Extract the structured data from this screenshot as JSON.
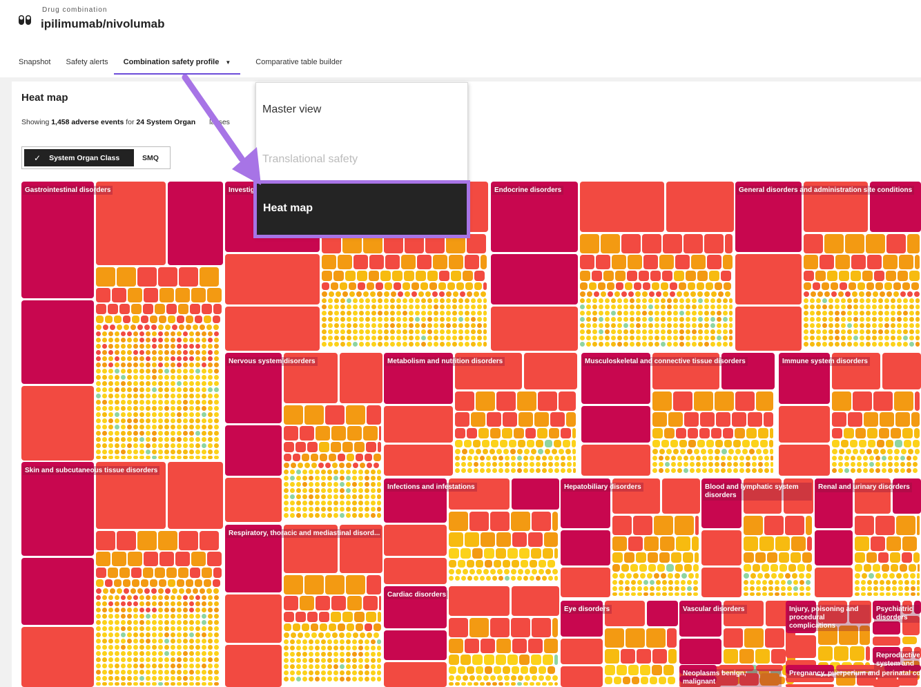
{
  "header": {
    "kicker": "Drug combination",
    "drug_name": "ipilimumab/nivolumab",
    "icon": "pill-capsules-icon"
  },
  "tabs": [
    {
      "label": "Snapshot"
    },
    {
      "label": "Safety alerts"
    },
    {
      "label": "Combination safety profile",
      "active": true
    },
    {
      "label": "Comparative table builder"
    }
  ],
  "panel": {
    "title": "Heat map",
    "showing_prefix": "Showing ",
    "event_count": "1,458 adverse events",
    "showing_mid": " for ",
    "soc_count": "24 System Organ",
    "showing_suffix": "lasses"
  },
  "toggle": {
    "selected": "System Organ Class",
    "other": "SMQ"
  },
  "dropdown": {
    "items": [
      "Master view",
      "Translational safety",
      "Heat map"
    ],
    "disabled": "Translational safety",
    "selected": "Heat map"
  },
  "treemap": {
    "groups": [
      "Gastrointestinal disorders",
      "Investig",
      "Endocrine disorders",
      "General disorders and administration site conditions",
      "Nervous system disorders",
      "Metabolism and nutrition disorders",
      "Musculoskeletal and connective tissue disorders",
      "Immune system disorders",
      "Skin and subcutaneous tissue disorders",
      "Infections and infestations",
      "Hepatobiliary disorders",
      "Blood and lymphatic system disorders",
      "Renal and urinary disorders",
      "Respiratory, thoracic and mediastinal disord...",
      "Cardiac disorders",
      "Eye disorders",
      "Vascular disorders",
      "Injury, poisoning and procedural complications",
      "Psychiatric disorders",
      "Reproductive system and",
      "Neoplasms benign, malignant",
      "Pregnancy, puerperium and perinatal conditions"
    ],
    "palette": {
      "crimson": "#c8074f",
      "red": "#f24a41",
      "orange": "#f39a12",
      "amber": "#f7bb10",
      "yellow": "#fcd21a",
      "green": "#8fd4a0"
    }
  },
  "annotation": {
    "arrow_color": "#a774e6"
  }
}
